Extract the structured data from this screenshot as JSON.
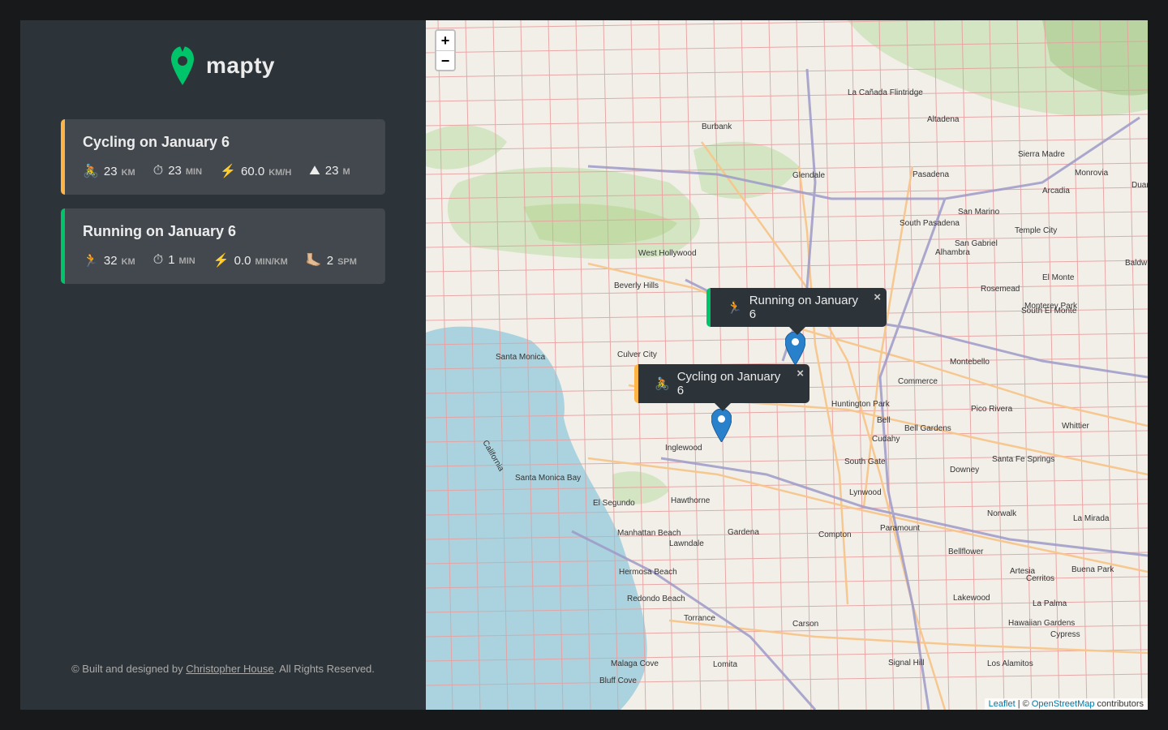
{
  "sidebar": {
    "logo_text": "mapty",
    "workouts": [
      {
        "type": "cycling",
        "title": "Cycling on January 6",
        "details": [
          {
            "icon": "🚴",
            "value": "23",
            "unit": "km"
          },
          {
            "icon": "⏱",
            "value": "23",
            "unit": "min"
          },
          {
            "icon": "⚡️",
            "value": "60.0",
            "unit": "km/h"
          },
          {
            "icon": "⛰",
            "value": "23",
            "unit": "m"
          }
        ]
      },
      {
        "type": "running",
        "title": "Running on January 6",
        "details": [
          {
            "icon": "🏃",
            "value": "32",
            "unit": "km"
          },
          {
            "icon": "⏱",
            "value": "1",
            "unit": "min"
          },
          {
            "icon": "⚡️",
            "value": "0.0",
            "unit": "min/km"
          },
          {
            "icon": "🦶🏼",
            "value": "2",
            "unit": "spm"
          }
        ]
      }
    ],
    "copyright": {
      "prefix": "© Built and designed by",
      "author": "Christopher House",
      "suffix": ". All Rights Reserved."
    }
  },
  "map": {
    "zoom_in": "+",
    "zoom_out": "−",
    "popups": [
      {
        "type": "running",
        "icon": "🏃",
        "text": "Running on January 6",
        "close": "×"
      },
      {
        "type": "cycling",
        "icon": "🚴",
        "text": "Cycling on January 6",
        "close": "×"
      }
    ],
    "attribution": {
      "leaflet": "Leaflet",
      "sep": " | © ",
      "osm": "OpenStreetMap",
      "suffix": " contributors"
    },
    "place_labels": [
      "La Cañada Flintridge",
      "Burbank",
      "Altadena",
      "Glendale",
      "Pasadena",
      "Sierra Madre",
      "Monrovia",
      "Arcadia",
      "Duarte",
      "San Marino",
      "South Pasadena",
      "Temple City",
      "San Gabriel",
      "Alhambra",
      "West Hollywood",
      "El Monte",
      "Baldw",
      "Beverly Hills",
      "Rosemead",
      "Monterey Park",
      "South El Monte",
      "Santa Monica",
      "Culver City",
      "Montebello",
      "Commerce",
      "Huntington Park",
      "Bell",
      "Pico Rivera",
      "Bell Gardens",
      "Cudahy",
      "Whittier",
      "California",
      "Inglewood",
      "South Gate",
      "Downey",
      "Santa Fe Springs",
      "Santa Monica Bay",
      "El Segundo",
      "Hawthorne",
      "Lynwood",
      "Norwalk",
      "La Mirada",
      "Paramount",
      "Manhattan Beach",
      "Lawndale",
      "Gardena",
      "Compton",
      "Bellflower",
      "Buena Park",
      "Hermosa Beach",
      "Artesia",
      "Cerritos",
      "Redondo Beach",
      "Lakewood",
      "La Palma",
      "Torrance",
      "Carson",
      "Hawaiian Gardens",
      "Cypress",
      "Lomita",
      "Malaga Cove",
      "Signal Hill",
      "Los Alamitos",
      "Bluff Cove"
    ]
  },
  "colors": {
    "cycling": "#ffb545",
    "running": "#00c46a",
    "sidebar_bg": "#2d3439",
    "card_bg": "#42484d",
    "ocean": "#aad3df"
  }
}
